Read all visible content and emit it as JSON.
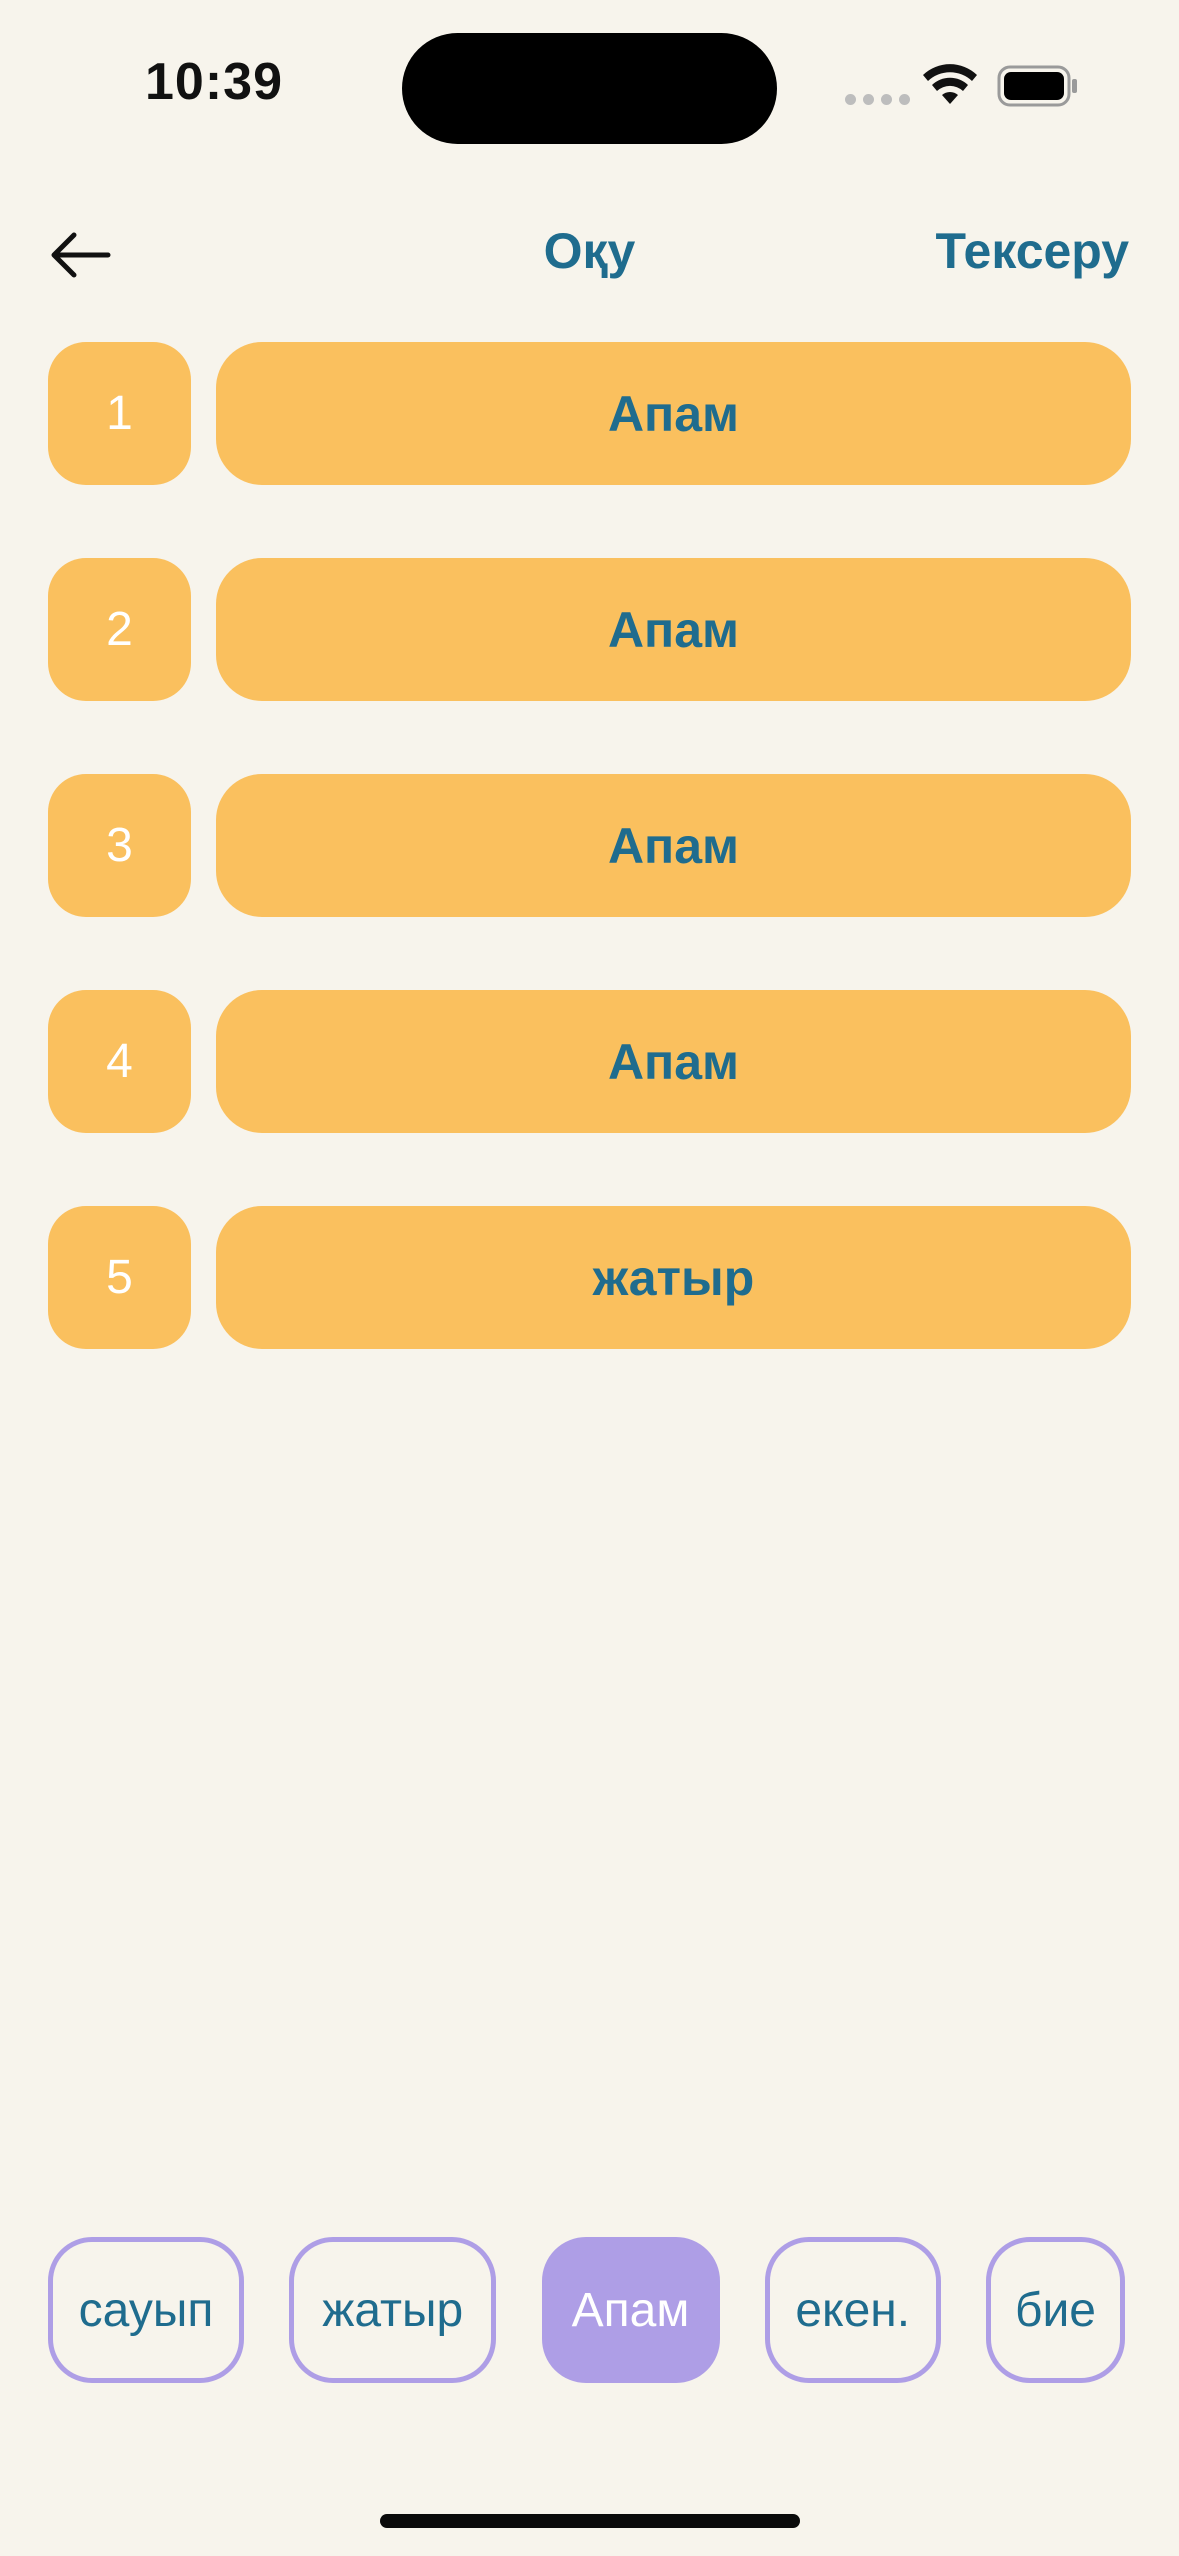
{
  "status_bar": {
    "time": "10:39"
  },
  "nav": {
    "back_icon": "arrow-left-icon",
    "title": "Оқу",
    "check_label": "Тексеру"
  },
  "rows": [
    {
      "number": "1",
      "word": "Апам"
    },
    {
      "number": "2",
      "word": "Апам"
    },
    {
      "number": "3",
      "word": "Апам"
    },
    {
      "number": "4",
      "word": "Апам"
    },
    {
      "number": "5",
      "word": "жатыр"
    }
  ],
  "word_bank": [
    {
      "word": "сауып",
      "selected": false
    },
    {
      "word": "жатыр",
      "selected": false
    },
    {
      "word": "Апам",
      "selected": true
    },
    {
      "word": "екен.",
      "selected": false
    },
    {
      "word": "бие",
      "selected": false
    }
  ],
  "colors": {
    "background": "#F7F4EC",
    "slot": "#FAC05E",
    "accent_text": "#1F6C8E",
    "chip_border": "#AE9EE6"
  }
}
